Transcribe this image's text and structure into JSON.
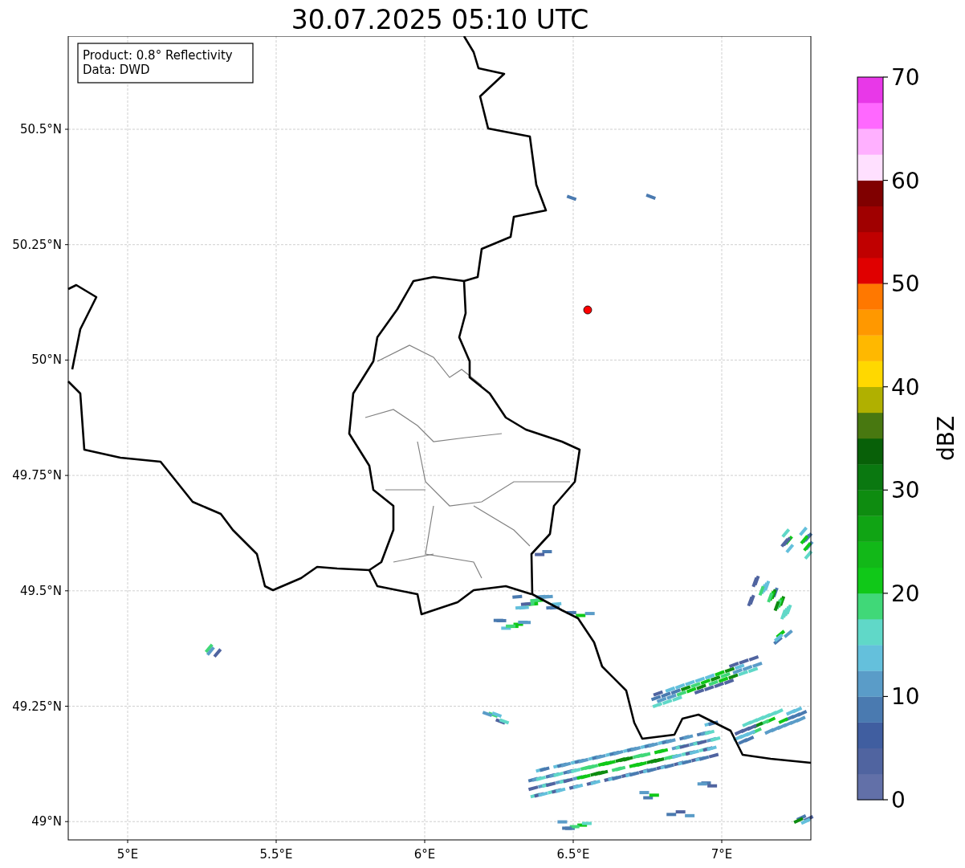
{
  "title": "30.07.2025 05:10 UTC",
  "info_box": [
    "Product: 0.8° Reflectivity",
    "Data: DWD"
  ],
  "map": {
    "x_ticks": [
      "5°E",
      "5.5°E",
      "6°E",
      "6.5°E",
      "7°E"
    ],
    "y_ticks": [
      "50.5°N",
      "50.25°N",
      "50°N",
      "49.75°N",
      "49.5°N",
      "49.25°N",
      "49°N"
    ]
  },
  "colorbar": {
    "label": "dBZ",
    "ticks": [
      "70",
      "60",
      "50",
      "40",
      "30",
      "20",
      "10",
      "0"
    ],
    "segments": [
      {
        "color": "#6270a8"
      },
      {
        "color": "#5064a0"
      },
      {
        "color": "#405ea0"
      },
      {
        "color": "#4a7ab0"
      },
      {
        "color": "#5a9cc8"
      },
      {
        "color": "#64c0dc"
      },
      {
        "color": "#60d8c8"
      },
      {
        "color": "#40d878"
      },
      {
        "color": "#10c818"
      },
      {
        "color": "#12b818"
      },
      {
        "color": "#10a414"
      },
      {
        "color": "#0e8c10"
      },
      {
        "color": "#0a7810"
      },
      {
        "color": "#086008"
      },
      {
        "color": "#487810"
      },
      {
        "color": "#b0b000"
      },
      {
        "color": "#ffd800"
      },
      {
        "color": "#ffb800"
      },
      {
        "color": "#ff9800"
      },
      {
        "color": "#ff7800"
      },
      {
        "color": "#e00000"
      },
      {
        "color": "#c00000"
      },
      {
        "color": "#a00000"
      },
      {
        "color": "#800000"
      },
      {
        "color": "#ffe0ff"
      },
      {
        "color": "#ffb0ff"
      },
      {
        "color": "#ff68ff"
      },
      {
        "color": "#e838e8"
      }
    ]
  }
}
